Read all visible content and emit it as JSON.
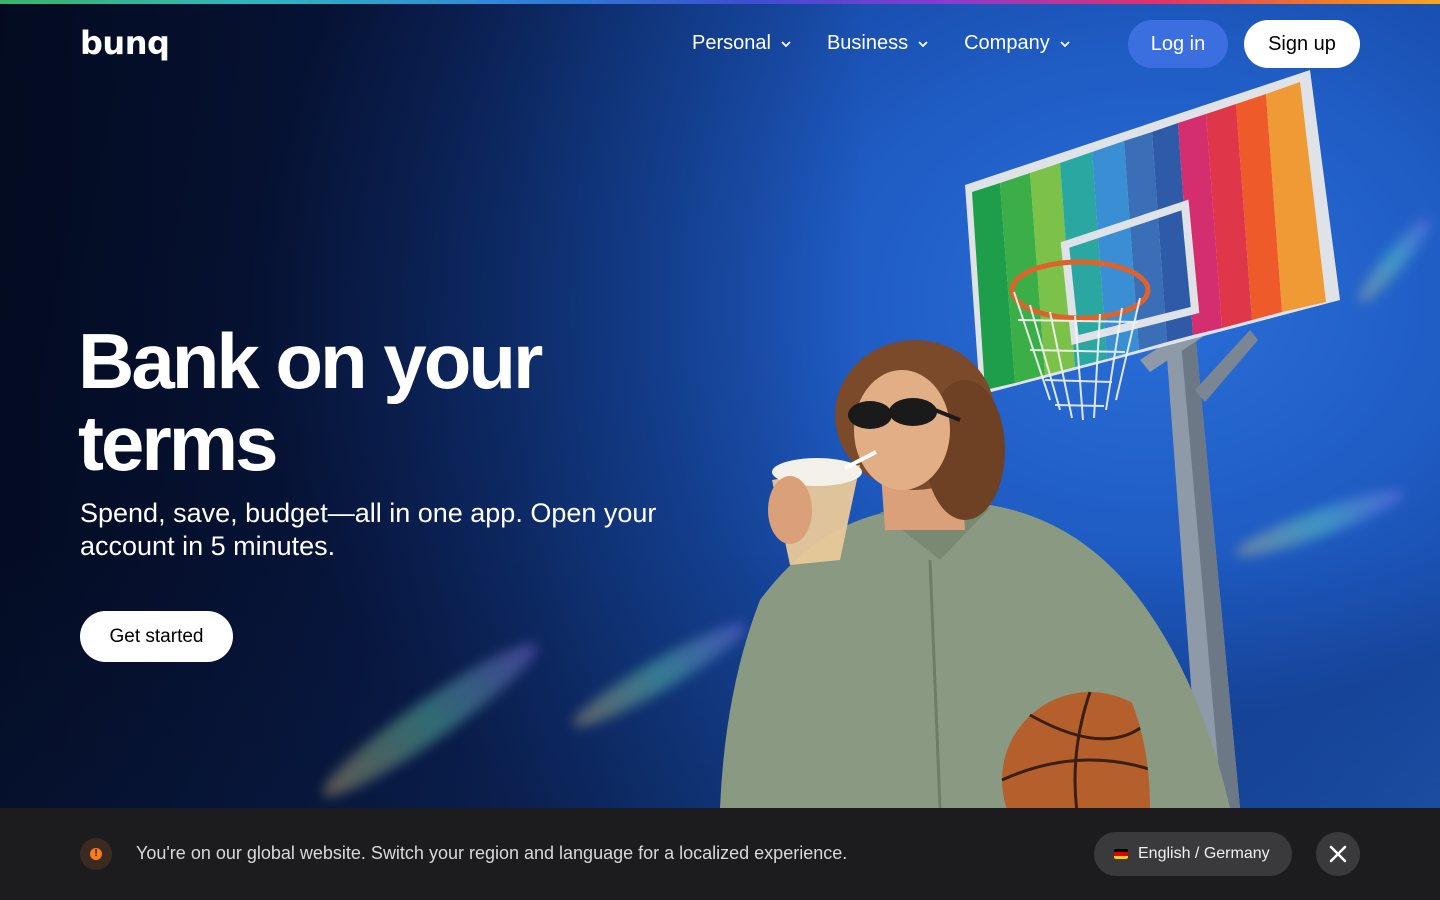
{
  "brand": {
    "logo": "bunq"
  },
  "nav": {
    "items": [
      {
        "label": "Personal"
      },
      {
        "label": "Business"
      },
      {
        "label": "Company"
      }
    ],
    "login_label": "Log in",
    "signup_label": "Sign up"
  },
  "hero": {
    "headline": "Bank on your terms",
    "subheadline": "Spend, save, budget—all in one app. Open your account in 5 minutes.",
    "cta_label": "Get started"
  },
  "banner": {
    "message": "You're on our global website. Switch your region and language for a localized experience.",
    "language_label": "English / Germany",
    "icons": [
      "warning-icon",
      "germany-flag-icon",
      "close-icon"
    ]
  },
  "colors": {
    "accent_blue": "#3b6fe0",
    "banner_bg": "#1c1c1e",
    "warning_orange": "#ff7a1a"
  }
}
